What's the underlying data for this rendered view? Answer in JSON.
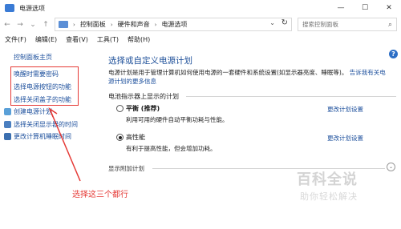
{
  "window": {
    "title": "电源选项",
    "minimize": "—",
    "maximize": "☐",
    "close": "✕"
  },
  "nav": {
    "back": "←",
    "forward": "→",
    "recent": "⌄",
    "up": "↑",
    "breadcrumbs": [
      "控制面板",
      "硬件和声音",
      "电源选项"
    ],
    "search_placeholder": "搜索控制面板"
  },
  "menu": [
    "文件(F)",
    "编辑(E)",
    "查看(V)",
    "工具(T)",
    "帮助(H)"
  ],
  "sidebar": {
    "home": "控制面板主页",
    "links": [
      "唤醒时需要密码",
      "选择电源按钮的功能",
      "选择关闭盖子的功能",
      "创建电源计划",
      "选择关闭显示器的时间",
      "更改计算机睡眠时间"
    ]
  },
  "annotation": {
    "text": "选择这三个都行",
    "color": "#e53935"
  },
  "main": {
    "heading": "选择或自定义电源计划",
    "description": "电源计划是用于管理计算机如何使用电源的一套硬件和系统设置(如显示器亮度、睡眠等)。",
    "description_link": "告诉我有关电源计划的更多信息",
    "section_title": "电池指示器上显示的计划",
    "plans": [
      {
        "name": "平衡 (推荐)",
        "desc": "利用可用的硬件自动平衡功耗与性能。",
        "selected": false,
        "link": "更改计划设置"
      },
      {
        "name": "高性能",
        "desc": "有利于提高性能，但会增加功耗。",
        "selected": true,
        "link": "更改计划设置"
      }
    ],
    "extra_title": "显示附加计划",
    "expand_icon": "⌄"
  },
  "watermark": {
    "title": "百科全说",
    "subtitle": "助你轻松解决"
  },
  "colors": {
    "link": "#1c4f9c",
    "accent": "#1d4f99",
    "annotation": "#e53935"
  }
}
